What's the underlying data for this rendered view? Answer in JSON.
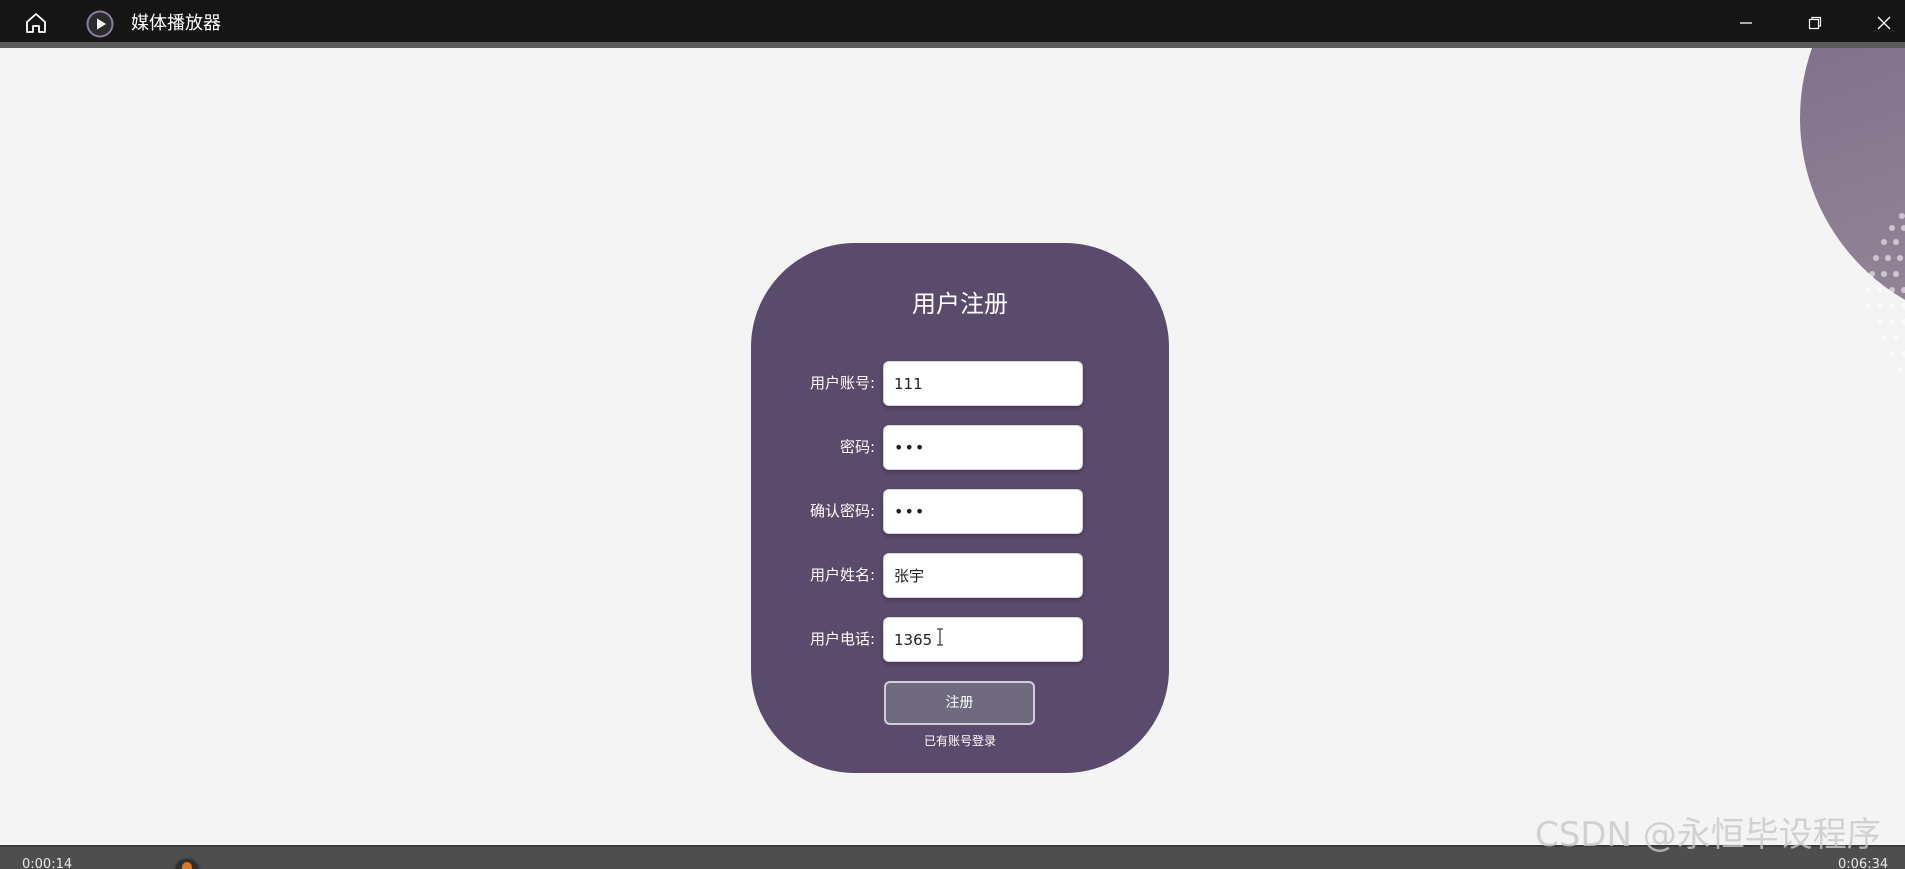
{
  "window": {
    "title": "媒体播放器",
    "controls": {
      "minimize_icon": "minimize-icon",
      "maximize_icon": "restore-icon",
      "close_icon": "close-icon"
    }
  },
  "form": {
    "title": "用户注册",
    "fields": [
      {
        "label": "用户账号:",
        "value": "111",
        "type": "text"
      },
      {
        "label": "密码:",
        "value": "123",
        "type": "password"
      },
      {
        "label": "确认密码:",
        "value": "123",
        "type": "password"
      },
      {
        "label": "用户姓名:",
        "value": "张宇",
        "type": "text"
      },
      {
        "label": "用户电话:",
        "value": "1365",
        "type": "text"
      }
    ],
    "submit_label": "注册",
    "login_link": "已有账号登录"
  },
  "player": {
    "time_left": "0:00:14",
    "time_right": "0:06:34"
  },
  "watermark": "CSDN @永恒毕设程序",
  "colors": {
    "card": "#5a4a6c",
    "titlebar": "#151515",
    "accent_knob": "#d7772a"
  }
}
